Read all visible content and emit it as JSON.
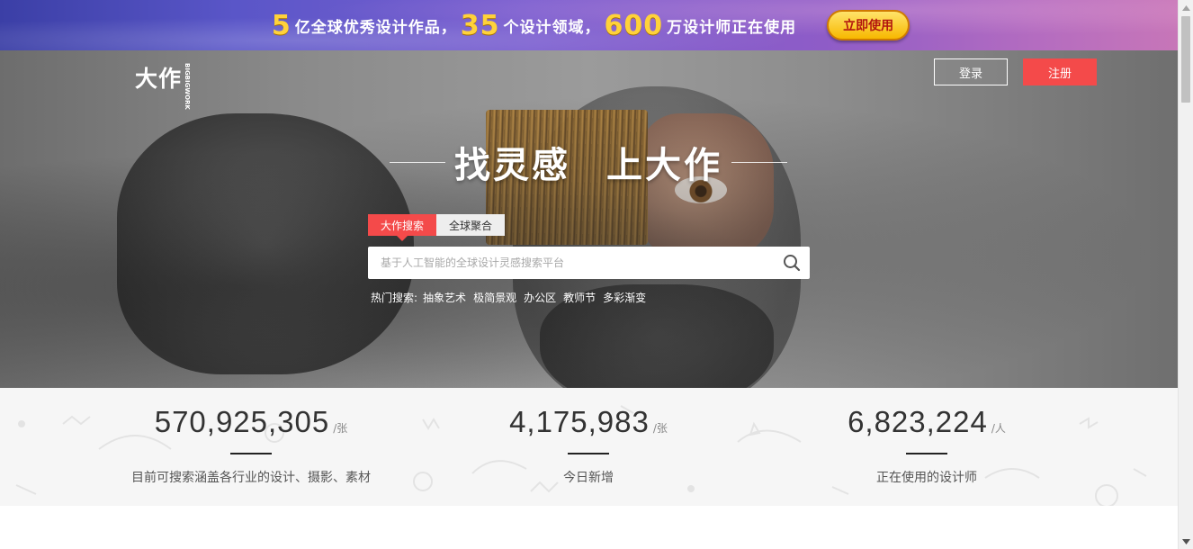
{
  "banner": {
    "seg1_num": "5",
    "seg1_text": "亿全球优秀设计作品，",
    "seg2_num": "35",
    "seg2_text": "个设计领域，",
    "seg3_num": "600",
    "seg3_text": "万设计师正在使用",
    "button_label": "立即使用"
  },
  "header": {
    "logo_text": "大作",
    "logo_subtext": "BIGBIGWORK",
    "login_label": "登录",
    "register_label": "注册"
  },
  "hero": {
    "title_part1": "找灵感",
    "title_part2": "上大作"
  },
  "search": {
    "tabs": [
      {
        "label": "大作搜索",
        "active": true
      },
      {
        "label": "全球聚合",
        "active": false
      }
    ],
    "placeholder": "基于人工智能的全球设计灵感搜索平台",
    "hot_label": "热门搜索:",
    "hot_items": [
      "抽象艺术",
      "极简景观",
      "办公区",
      "教师节",
      "多彩渐变"
    ]
  },
  "stats": [
    {
      "value": "570,925,305",
      "unit": "/张",
      "desc": "目前可搜索涵盖各行业的设计、摄影、素材"
    },
    {
      "value": "4,175,983",
      "unit": "/张",
      "desc": "今日新增"
    },
    {
      "value": "6,823,224",
      "unit": "/人",
      "desc": "正在使用的设计师"
    }
  ],
  "colors": {
    "accent": "#f44a4a",
    "banner_number": "#ffd23a",
    "stats_bg": "#f6f6f6"
  },
  "icons": {
    "search": "search-icon"
  }
}
